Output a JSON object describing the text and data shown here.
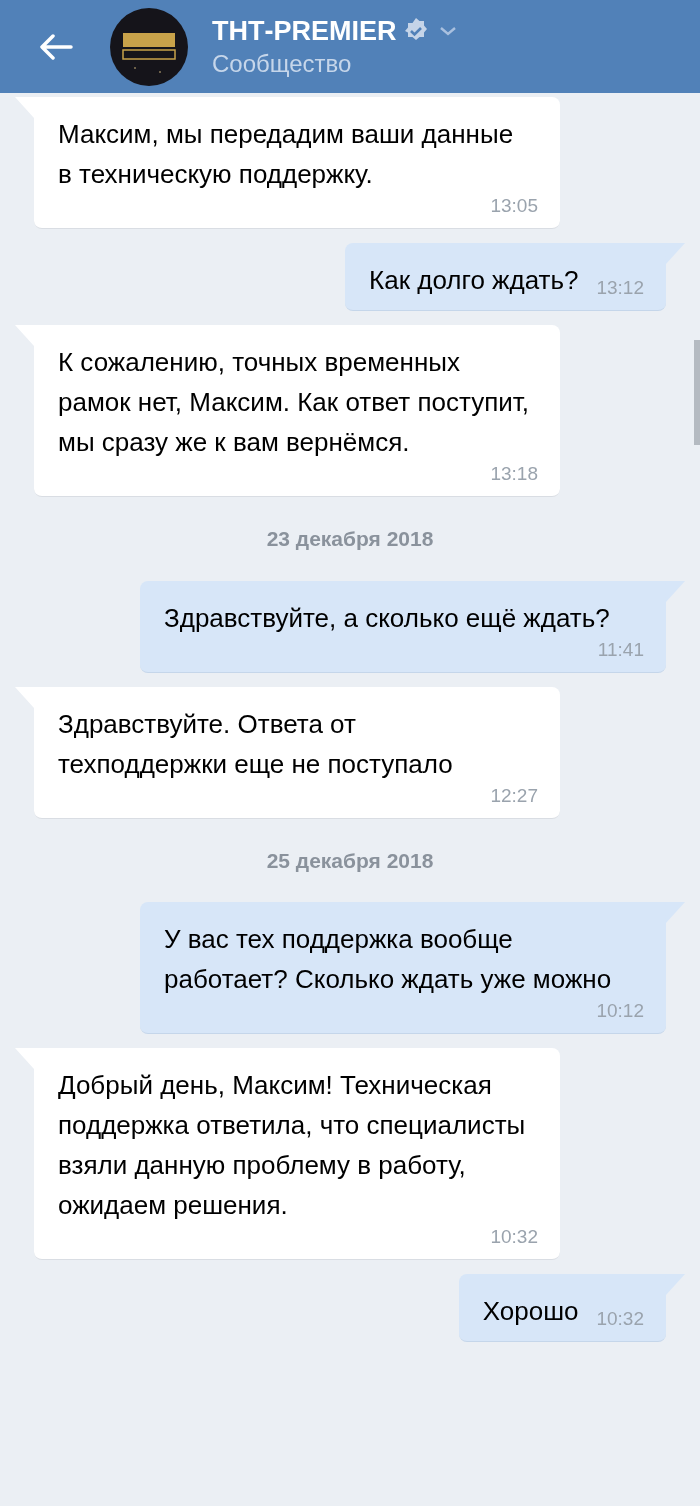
{
  "header": {
    "title": "ТНТ-PREMIER",
    "subtitle": "Сообщество",
    "verified": true
  },
  "messages": [
    {
      "kind": "incoming",
      "text": "Максим, мы передадим ваши данные в техническую поддержку.",
      "time": "13:05"
    },
    {
      "kind": "outgoing",
      "text": "Как долго ждать?",
      "time": "13:12"
    },
    {
      "kind": "incoming",
      "text": "К сожалению, точных временных рамок нет, Максим. Как ответ поступит, мы сразу же к вам вернёмся.",
      "time": "13:18"
    },
    {
      "kind": "date",
      "text": "23 декабря 2018"
    },
    {
      "kind": "outgoing",
      "text": "Здравствуйте, а сколько ещё ждать?",
      "time": "11:41"
    },
    {
      "kind": "incoming",
      "text": "Здравствуйте. Ответа от техподдержки еще не поступало",
      "time": "12:27"
    },
    {
      "kind": "date",
      "text": "25 декабря 2018"
    },
    {
      "kind": "outgoing",
      "text": "У вас тех поддержка вообще работает? Сколько ждать уже можно",
      "time": "10:12"
    },
    {
      "kind": "incoming",
      "text": "Добрый день, Максим! Техническая поддержка ответила, что специалисты взяли данную проблему в работу, ожидаем решения.",
      "time": "10:32"
    },
    {
      "kind": "outgoing",
      "text": "Хорошо",
      "time": "10:32"
    }
  ]
}
